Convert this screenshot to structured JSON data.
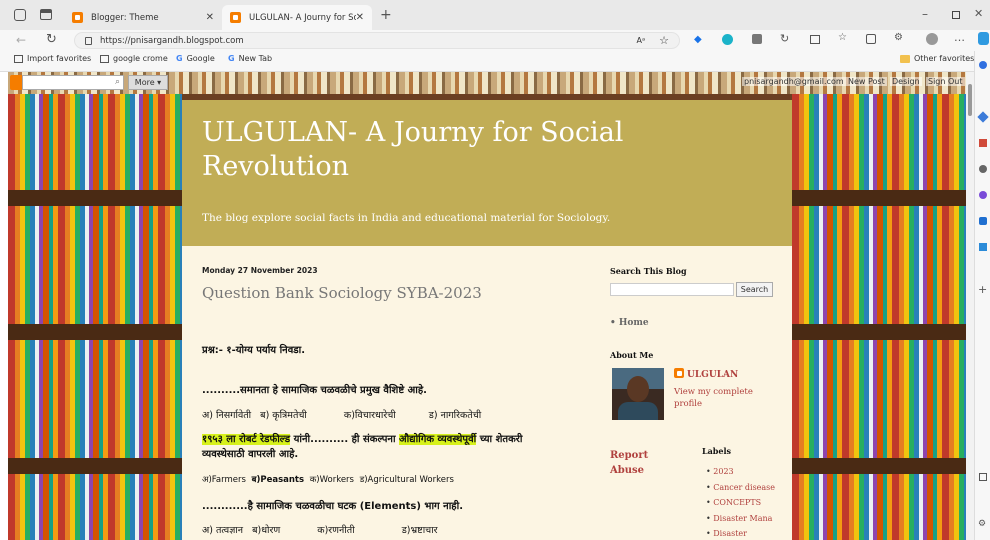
{
  "browser": {
    "tabs": [
      {
        "title": "Blogger: Theme",
        "active": false
      },
      {
        "title": "ULGULAN- A Journy for Social Re",
        "active": true
      }
    ],
    "url": "https://pnisargandh.blogspot.com",
    "bookmarks": [
      "Import favorites",
      "google crome",
      "Google",
      "New Tab"
    ],
    "other_favorites": "Other favorites"
  },
  "navbar": {
    "more": "More ▾",
    "email": "pnisargandh@gmail.com",
    "new_post": "New Post",
    "design": "Design",
    "sign_out": "Sign Out"
  },
  "blog": {
    "title": "ULGULAN- A Journy for Social Revolution",
    "description": "The blog explore social facts in India and educational material for Sociology."
  },
  "post": {
    "date": "Monday 27 November 2023",
    "title": "Question Bank Sociology SYBA-2023",
    "instruction": "प्रश्न:- १-योग्य पर्याय निवडा.",
    "q1": "..........समानता हे सामाजिक चळवळीचे प्रमुख वैशिष्टे आहे.",
    "q1_options": [
      "अ) निसर्गावेती",
      "ब) कृत्रिमतेची",
      "क)विचारधारेची",
      "ड) नागरिकतेची"
    ],
    "q2_highlight1": "१९५३ ला रोबर्ट रेडफील्ड",
    "q2_text1": " यांनी.......... ही संकल्पना ",
    "q2_highlight2": "औद्योगिक व्यवस्थेपूर्वी",
    "q2_text2": " च्या शेतकरी व्यवस्थेसाठी वापरली आहे.",
    "q2_options": [
      "अ)Farmers",
      "ब)Peasants",
      "क)Workers",
      "ड)Agricultural Workers"
    ],
    "q3": "............है सामाजिक चळवळीचा घटक (Elements) भाग नाही.",
    "q3_options": [
      "अ) तत्वज्ञान",
      "ब)धोरण",
      "क)रणनीती",
      "ड)भ्रष्टाचार"
    ]
  },
  "sidebar": {
    "search_title": "Search This Blog",
    "search_button": "Search",
    "home": "Home",
    "about_title": "About Me",
    "profile_name": "ULGULAN",
    "profile_link": "View my complete profile",
    "report_abuse": "Report Abuse",
    "labels_title": "Labels",
    "labels": [
      "2023",
      "Cancer disease",
      "CONCEPTS",
      "Disaster Mana",
      "Disaster"
    ]
  },
  "colors": {
    "header_bg": "#c1ad56",
    "content_bg": "#fcf5e3",
    "link": "#b0413e",
    "highlight": "#d7f11b"
  }
}
